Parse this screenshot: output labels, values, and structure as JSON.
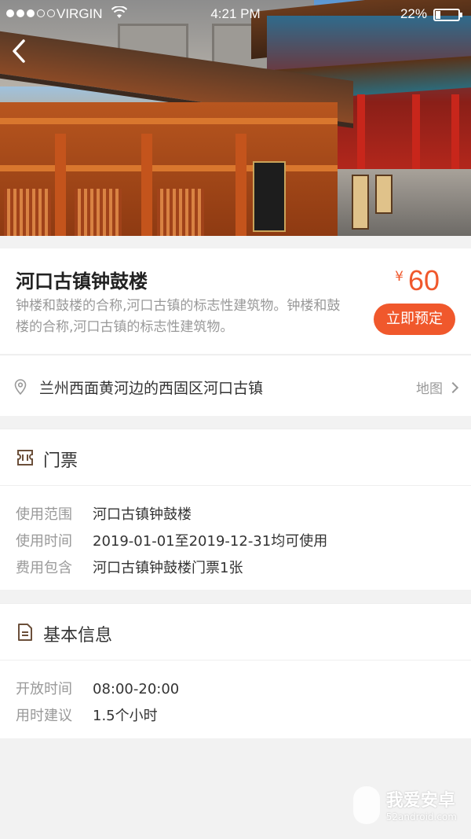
{
  "status_bar": {
    "carrier": "VIRGIN",
    "time": "4:21 PM",
    "battery": "22%",
    "battery_level": 0.22
  },
  "header": {
    "back_icon": "chevron-left-icon"
  },
  "attraction": {
    "title": "河口古镇钟鼓楼",
    "description": "钟楼和鼓楼的合称,河口古镇的标志性建筑物。钟楼和鼓楼的合称,河口古镇的标志性建筑物。",
    "price_currency": "¥",
    "price_value": "60",
    "book_label": "立即预定",
    "accent_color": "#f0582c"
  },
  "location": {
    "icon": "map-pin-icon",
    "address": "兰州西面黄河边的西固区河口古镇",
    "map_label": "地图"
  },
  "ticket_section": {
    "title": "门票",
    "icon": "ticket-icon",
    "rows": [
      {
        "label": "使用范围",
        "value": "河口古镇钟鼓楼"
      },
      {
        "label": "使用时间",
        "value": "2019-01-01至2019-12-31均可使用"
      },
      {
        "label": "费用包含",
        "value": "河口古镇钟鼓楼门票1张"
      }
    ]
  },
  "basic_section": {
    "title": "基本信息",
    "icon": "document-icon",
    "rows": [
      {
        "label": "开放时间",
        "value": "08:00-20:00"
      },
      {
        "label": "用时建议",
        "value": "1.5个小时"
      }
    ]
  },
  "watermark": {
    "name": "我爱安卓",
    "url": "52android.com"
  }
}
